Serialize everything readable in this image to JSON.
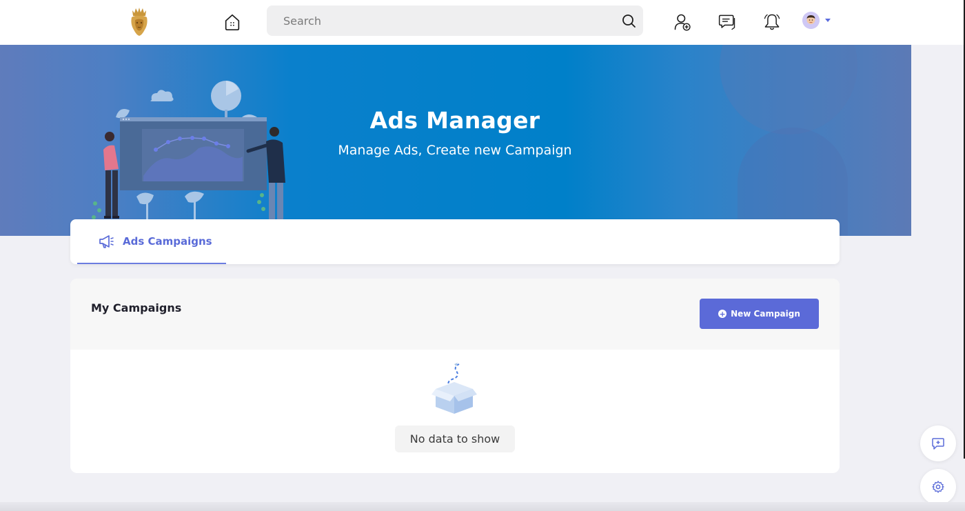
{
  "topbar": {
    "search_placeholder": "Search"
  },
  "banner": {
    "title": "Ads Manager",
    "subtitle": "Manage Ads, Create new Campaign"
  },
  "tabs": [
    {
      "label": "Ads Campaigns",
      "active": true
    }
  ],
  "campaigns": {
    "title": "My Campaigns",
    "new_button_label": "New Campaign",
    "empty_text": "No data to show"
  },
  "colors": {
    "accent": "#5b6ad8",
    "banner_blue": "#0080c9"
  },
  "icons": {
    "home": "home-icon",
    "search": "search-icon",
    "add_friend": "add-friend-icon",
    "messages": "messages-icon",
    "notifications": "bell-icon",
    "tab": "megaphone-icon",
    "float_chat": "chat-plus-icon",
    "float_settings": "gear-icon"
  }
}
